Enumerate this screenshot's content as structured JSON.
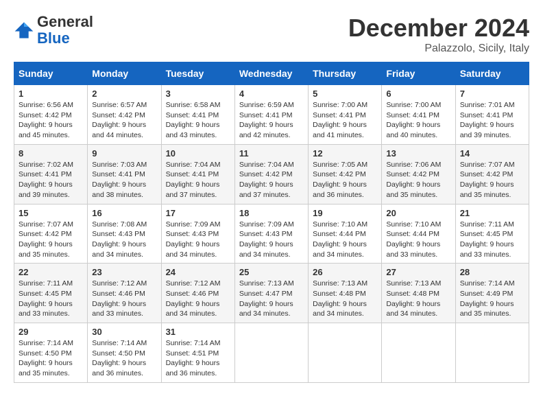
{
  "header": {
    "logo": {
      "general": "General",
      "blue": "Blue"
    },
    "title": "December 2024",
    "location": "Palazzolo, Sicily, Italy"
  },
  "weekdays": [
    "Sunday",
    "Monday",
    "Tuesday",
    "Wednesday",
    "Thursday",
    "Friday",
    "Saturday"
  ],
  "weeks": [
    [
      {
        "day": 1,
        "sunrise": "Sunrise: 6:56 AM",
        "sunset": "Sunset: 4:42 PM",
        "daylight": "Daylight: 9 hours and 45 minutes."
      },
      {
        "day": 2,
        "sunrise": "Sunrise: 6:57 AM",
        "sunset": "Sunset: 4:42 PM",
        "daylight": "Daylight: 9 hours and 44 minutes."
      },
      {
        "day": 3,
        "sunrise": "Sunrise: 6:58 AM",
        "sunset": "Sunset: 4:41 PM",
        "daylight": "Daylight: 9 hours and 43 minutes."
      },
      {
        "day": 4,
        "sunrise": "Sunrise: 6:59 AM",
        "sunset": "Sunset: 4:41 PM",
        "daylight": "Daylight: 9 hours and 42 minutes."
      },
      {
        "day": 5,
        "sunrise": "Sunrise: 7:00 AM",
        "sunset": "Sunset: 4:41 PM",
        "daylight": "Daylight: 9 hours and 41 minutes."
      },
      {
        "day": 6,
        "sunrise": "Sunrise: 7:00 AM",
        "sunset": "Sunset: 4:41 PM",
        "daylight": "Daylight: 9 hours and 40 minutes."
      },
      {
        "day": 7,
        "sunrise": "Sunrise: 7:01 AM",
        "sunset": "Sunset: 4:41 PM",
        "daylight": "Daylight: 9 hours and 39 minutes."
      }
    ],
    [
      {
        "day": 8,
        "sunrise": "Sunrise: 7:02 AM",
        "sunset": "Sunset: 4:41 PM",
        "daylight": "Daylight: 9 hours and 39 minutes."
      },
      {
        "day": 9,
        "sunrise": "Sunrise: 7:03 AM",
        "sunset": "Sunset: 4:41 PM",
        "daylight": "Daylight: 9 hours and 38 minutes."
      },
      {
        "day": 10,
        "sunrise": "Sunrise: 7:04 AM",
        "sunset": "Sunset: 4:41 PM",
        "daylight": "Daylight: 9 hours and 37 minutes."
      },
      {
        "day": 11,
        "sunrise": "Sunrise: 7:04 AM",
        "sunset": "Sunset: 4:42 PM",
        "daylight": "Daylight: 9 hours and 37 minutes."
      },
      {
        "day": 12,
        "sunrise": "Sunrise: 7:05 AM",
        "sunset": "Sunset: 4:42 PM",
        "daylight": "Daylight: 9 hours and 36 minutes."
      },
      {
        "day": 13,
        "sunrise": "Sunrise: 7:06 AM",
        "sunset": "Sunset: 4:42 PM",
        "daylight": "Daylight: 9 hours and 35 minutes."
      },
      {
        "day": 14,
        "sunrise": "Sunrise: 7:07 AM",
        "sunset": "Sunset: 4:42 PM",
        "daylight": "Daylight: 9 hours and 35 minutes."
      }
    ],
    [
      {
        "day": 15,
        "sunrise": "Sunrise: 7:07 AM",
        "sunset": "Sunset: 4:42 PM",
        "daylight": "Daylight: 9 hours and 35 minutes."
      },
      {
        "day": 16,
        "sunrise": "Sunrise: 7:08 AM",
        "sunset": "Sunset: 4:43 PM",
        "daylight": "Daylight: 9 hours and 34 minutes."
      },
      {
        "day": 17,
        "sunrise": "Sunrise: 7:09 AM",
        "sunset": "Sunset: 4:43 PM",
        "daylight": "Daylight: 9 hours and 34 minutes."
      },
      {
        "day": 18,
        "sunrise": "Sunrise: 7:09 AM",
        "sunset": "Sunset: 4:43 PM",
        "daylight": "Daylight: 9 hours and 34 minutes."
      },
      {
        "day": 19,
        "sunrise": "Sunrise: 7:10 AM",
        "sunset": "Sunset: 4:44 PM",
        "daylight": "Daylight: 9 hours and 34 minutes."
      },
      {
        "day": 20,
        "sunrise": "Sunrise: 7:10 AM",
        "sunset": "Sunset: 4:44 PM",
        "daylight": "Daylight: 9 hours and 33 minutes."
      },
      {
        "day": 21,
        "sunrise": "Sunrise: 7:11 AM",
        "sunset": "Sunset: 4:45 PM",
        "daylight": "Daylight: 9 hours and 33 minutes."
      }
    ],
    [
      {
        "day": 22,
        "sunrise": "Sunrise: 7:11 AM",
        "sunset": "Sunset: 4:45 PM",
        "daylight": "Daylight: 9 hours and 33 minutes."
      },
      {
        "day": 23,
        "sunrise": "Sunrise: 7:12 AM",
        "sunset": "Sunset: 4:46 PM",
        "daylight": "Daylight: 9 hours and 33 minutes."
      },
      {
        "day": 24,
        "sunrise": "Sunrise: 7:12 AM",
        "sunset": "Sunset: 4:46 PM",
        "daylight": "Daylight: 9 hours and 34 minutes."
      },
      {
        "day": 25,
        "sunrise": "Sunrise: 7:13 AM",
        "sunset": "Sunset: 4:47 PM",
        "daylight": "Daylight: 9 hours and 34 minutes."
      },
      {
        "day": 26,
        "sunrise": "Sunrise: 7:13 AM",
        "sunset": "Sunset: 4:48 PM",
        "daylight": "Daylight: 9 hours and 34 minutes."
      },
      {
        "day": 27,
        "sunrise": "Sunrise: 7:13 AM",
        "sunset": "Sunset: 4:48 PM",
        "daylight": "Daylight: 9 hours and 34 minutes."
      },
      {
        "day": 28,
        "sunrise": "Sunrise: 7:14 AM",
        "sunset": "Sunset: 4:49 PM",
        "daylight": "Daylight: 9 hours and 35 minutes."
      }
    ],
    [
      {
        "day": 29,
        "sunrise": "Sunrise: 7:14 AM",
        "sunset": "Sunset: 4:50 PM",
        "daylight": "Daylight: 9 hours and 35 minutes."
      },
      {
        "day": 30,
        "sunrise": "Sunrise: 7:14 AM",
        "sunset": "Sunset: 4:50 PM",
        "daylight": "Daylight: 9 hours and 36 minutes."
      },
      {
        "day": 31,
        "sunrise": "Sunrise: 7:14 AM",
        "sunset": "Sunset: 4:51 PM",
        "daylight": "Daylight: 9 hours and 36 minutes."
      },
      null,
      null,
      null,
      null
    ]
  ]
}
